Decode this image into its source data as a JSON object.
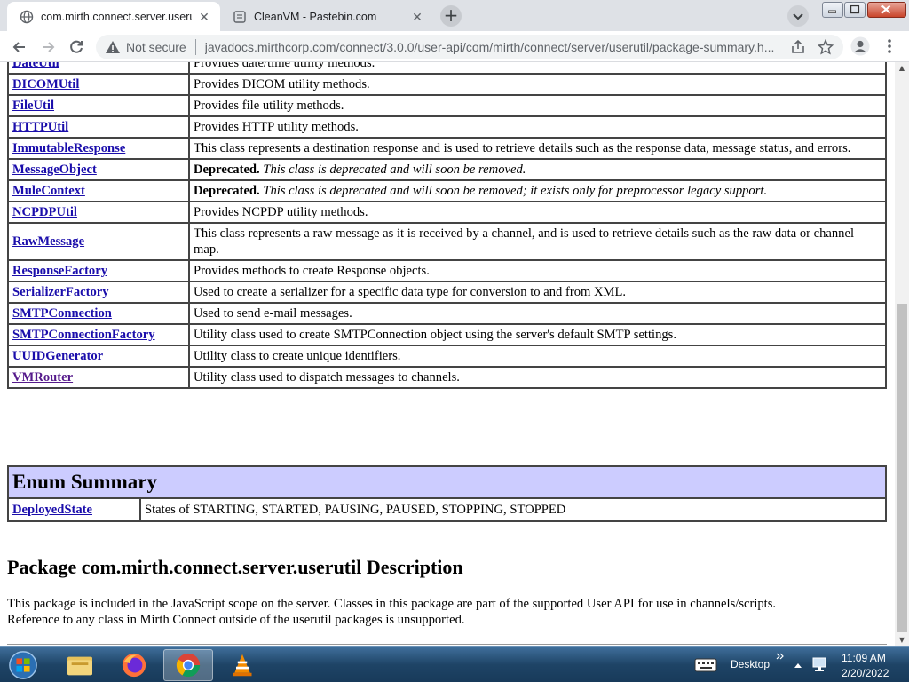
{
  "browser": {
    "tabs": [
      {
        "title": "com.mirth.connect.server.userutil",
        "active": true
      },
      {
        "title": "CleanVM - Pastebin.com",
        "active": false
      }
    ],
    "new_tab_label": "+",
    "address": {
      "security_label": "Not secure",
      "url": "javadocs.mirthcorp.com/connect/3.0.0/user-api/com/mirth/connect/server/userutil/package-summary.h..."
    }
  },
  "page": {
    "classes": [
      {
        "name": "DateUtil",
        "desc": "Provides date/time utility methods."
      },
      {
        "name": "DICOMUtil",
        "desc": "Provides DICOM utility methods."
      },
      {
        "name": "FileUtil",
        "desc": "Provides file utility methods."
      },
      {
        "name": "HTTPUtil",
        "desc": "Provides HTTP utility methods."
      },
      {
        "name": "ImmutableResponse",
        "desc": "This class represents a destination response and is used to retrieve details such as the response data, message status, and errors."
      },
      {
        "name": "MessageObject",
        "deprecated_label": "Deprecated.",
        "deprecated_text": "This class is deprecated and will soon be removed."
      },
      {
        "name": "MuleContext",
        "deprecated_label": "Deprecated.",
        "deprecated_text": "This class is deprecated and will soon be removed; it exists only for preprocessor legacy support."
      },
      {
        "name": "NCPDPUtil",
        "desc": "Provides NCPDP utility methods."
      },
      {
        "name": "RawMessage",
        "desc": "This class represents a raw message as it is received by a channel, and is used to retrieve details such as the raw data or channel map."
      },
      {
        "name": "ResponseFactory",
        "desc": "Provides methods to create Response objects."
      },
      {
        "name": "SerializerFactory",
        "desc": "Used to create a serializer for a specific data type for conversion to and from XML."
      },
      {
        "name": "SMTPConnection",
        "desc": "Used to send e-mail messages."
      },
      {
        "name": "SMTPConnectionFactory",
        "desc": "Utility class used to create SMTPConnection object using the server's default SMTP settings."
      },
      {
        "name": "UUIDGenerator",
        "desc": "Utility class to create unique identifiers."
      },
      {
        "name": "VMRouter",
        "desc": "Utility class used to dispatch messages to channels.",
        "visited": true
      }
    ],
    "enum_summary": {
      "heading": "Enum Summary",
      "rows": [
        {
          "name": "DeployedState",
          "desc": "States of STARTING, STARTED, PAUSING, PAUSED, STOPPING, STOPPED"
        }
      ]
    },
    "description": {
      "heading": "Package com.mirth.connect.server.userutil Description",
      "text": "This package is included in the JavaScript scope on the server. Classes in this package are part of the supported User API for use in channels/scripts. Reference to any class in Mirth Connect outside of the userutil packages is unsupported."
    }
  },
  "taskbar": {
    "apps": [
      "start-orb-icon",
      "file-explorer-icon",
      "firefox-icon",
      "chrome-icon",
      "vlc-icon"
    ],
    "desktop_label": "Desktop",
    "clock_time": "11:09 AM",
    "clock_date": "2/20/2022"
  },
  "colors": {
    "link": "#1a0dab",
    "visited_link": "#551a8b",
    "table_header_bg": "#ccccff",
    "tab_strip_bg": "#dee1e6"
  }
}
